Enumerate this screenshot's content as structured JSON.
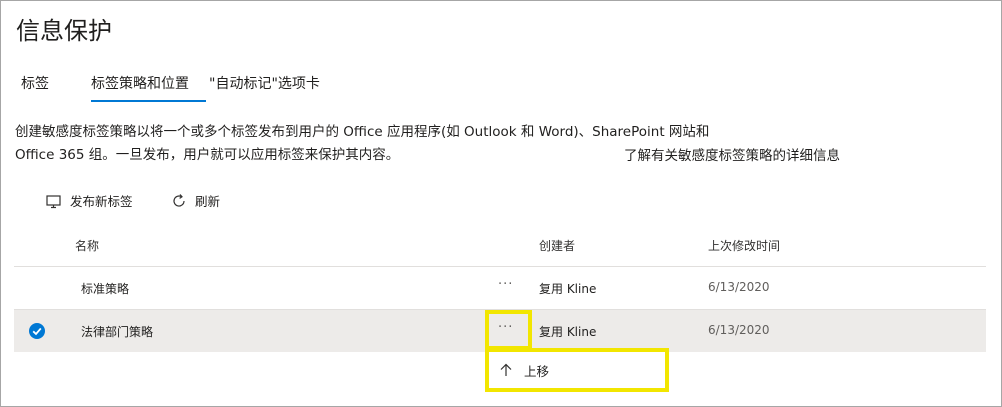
{
  "page_title": "信息保护",
  "tabs": [
    {
      "label": "标签"
    },
    {
      "label": "标签策略和位置"
    },
    {
      "label": "\"自动标记\"选项卡"
    }
  ],
  "description": {
    "line1": "创建敏感度标签策略以将一个或多个标签发布到用户的 Office 应用程序(如 Outlook 和 Word)、SharePoint 网站和",
    "line2": "Office 365 组。一旦发布，用户就可以应用标签来保护其内容。",
    "learn_more": "了解有关敏感度标签策略的详细信息"
  },
  "toolbar": {
    "publish_label": "发布新标签",
    "refresh_label": "刷新"
  },
  "table": {
    "headers": {
      "name": "名称",
      "creator": "创建者",
      "modified": "上次修改时间"
    },
    "rows": [
      {
        "name": "标准策略",
        "more": "···",
        "creator": "复用 Kline",
        "modified": "6/13/2020",
        "selected": false
      },
      {
        "name": "法律部门策略",
        "more": "···",
        "creator": "复用 Kline",
        "modified": "6/13/2020",
        "selected": true
      }
    ]
  },
  "context_menu": {
    "items": [
      {
        "label": "上移",
        "icon": "arrow-up-icon"
      }
    ]
  },
  "colors": {
    "accent": "#0078d4",
    "highlight": "#f2e600",
    "selected_row": "#edebe9"
  }
}
